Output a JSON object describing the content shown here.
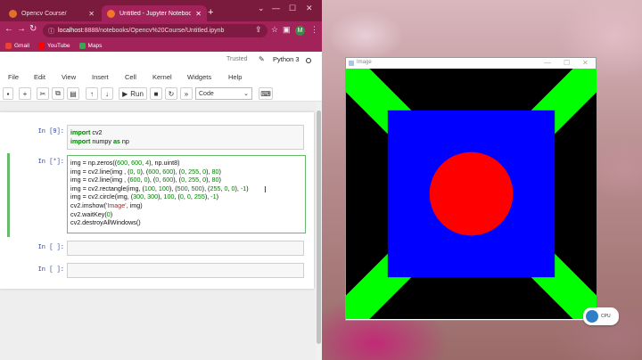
{
  "browser": {
    "tabs": [
      {
        "title": "Opencv Course/",
        "active": false,
        "favicon_color": "#e46f2a"
      },
      {
        "title": "Untitled - Jupyter Notebook",
        "active": true,
        "favicon_color": "#f37626"
      }
    ],
    "url_host": "localhost",
    "url_path": ":8888/notebooks/Opencv%20Course/Untitled.ipynb",
    "bookmarks": [
      {
        "label": "Gmail",
        "icon": "gmail-icon",
        "color": "#ea4335"
      },
      {
        "label": "YouTube",
        "icon": "youtube-icon",
        "color": "#ff0000"
      },
      {
        "label": "Maps",
        "icon": "maps-icon",
        "color": "#34a853"
      }
    ],
    "avatar_letter": "M",
    "theme_color": "#a2225a"
  },
  "jupyter": {
    "trusted_label": "Trusted",
    "kernel_name": "Python 3",
    "menus": [
      "File",
      "Edit",
      "View",
      "Insert",
      "Cell",
      "Kernel",
      "Widgets",
      "Help"
    ],
    "run_label": "Run",
    "cell_type": "Code",
    "cells": [
      {
        "prompt": "In [9]:",
        "lines": [
          [
            {
              "t": "import",
              "c": "kw"
            },
            {
              "t": " cv2",
              "c": ""
            }
          ],
          [
            {
              "t": "import",
              "c": "kw"
            },
            {
              "t": " numpy ",
              "c": ""
            },
            {
              "t": "as",
              "c": "kw"
            },
            {
              "t": " np",
              "c": ""
            }
          ]
        ]
      },
      {
        "prompt": "In [*]:",
        "lines": [
          [
            {
              "t": "img = np.zeros((",
              "c": ""
            },
            {
              "t": "600",
              "c": "num"
            },
            {
              "t": ", ",
              "c": ""
            },
            {
              "t": "600",
              "c": "num"
            },
            {
              "t": ", ",
              "c": ""
            },
            {
              "t": "4",
              "c": "num"
            },
            {
              "t": "), np.uint8)",
              "c": ""
            }
          ],
          [
            {
              "t": "img = cv2.line(img , (",
              "c": ""
            },
            {
              "t": "0",
              "c": "num"
            },
            {
              "t": ", ",
              "c": ""
            },
            {
              "t": "0",
              "c": "num"
            },
            {
              "t": "), (",
              "c": ""
            },
            {
              "t": "600",
              "c": "num"
            },
            {
              "t": ", ",
              "c": ""
            },
            {
              "t": "600",
              "c": "num"
            },
            {
              "t": "), (",
              "c": ""
            },
            {
              "t": "0",
              "c": "num"
            },
            {
              "t": ", ",
              "c": ""
            },
            {
              "t": "255",
              "c": "num"
            },
            {
              "t": ", ",
              "c": ""
            },
            {
              "t": "0",
              "c": "num"
            },
            {
              "t": "), ",
              "c": ""
            },
            {
              "t": "80",
              "c": "num"
            },
            {
              "t": ")",
              "c": ""
            }
          ],
          [
            {
              "t": "img = cv2.line(img , (",
              "c": ""
            },
            {
              "t": "600",
              "c": "num"
            },
            {
              "t": ", ",
              "c": ""
            },
            {
              "t": "0",
              "c": "num"
            },
            {
              "t": "), (",
              "c": ""
            },
            {
              "t": "0",
              "c": "num"
            },
            {
              "t": ", ",
              "c": ""
            },
            {
              "t": "600",
              "c": "num"
            },
            {
              "t": "), (",
              "c": ""
            },
            {
              "t": "0",
              "c": "num"
            },
            {
              "t": ", ",
              "c": ""
            },
            {
              "t": "255",
              "c": "num"
            },
            {
              "t": ", ",
              "c": ""
            },
            {
              "t": "0",
              "c": "num"
            },
            {
              "t": "), ",
              "c": ""
            },
            {
              "t": "80",
              "c": "num"
            },
            {
              "t": ")",
              "c": ""
            }
          ],
          [
            {
              "t": "img = cv2.rectangle(img, (",
              "c": ""
            },
            {
              "t": "100",
              "c": "num"
            },
            {
              "t": ", ",
              "c": ""
            },
            {
              "t": "100",
              "c": "num"
            },
            {
              "t": "), (",
              "c": ""
            },
            {
              "t": "500",
              "c": "num"
            },
            {
              "t": ", ",
              "c": ""
            },
            {
              "t": "500",
              "c": "num"
            },
            {
              "t": "), (",
              "c": ""
            },
            {
              "t": "255",
              "c": "num"
            },
            {
              "t": ", ",
              "c": ""
            },
            {
              "t": "0",
              "c": "num"
            },
            {
              "t": ", ",
              "c": ""
            },
            {
              "t": "0",
              "c": "num"
            },
            {
              "t": "), ",
              "c": ""
            },
            {
              "t": "-1",
              "c": "num"
            },
            {
              "t": ")",
              "c": ""
            }
          ],
          [
            {
              "t": "img = cv2.circle(img, (",
              "c": ""
            },
            {
              "t": "300",
              "c": "num"
            },
            {
              "t": ", ",
              "c": ""
            },
            {
              "t": "300",
              "c": "num"
            },
            {
              "t": "), ",
              "c": ""
            },
            {
              "t": "100",
              "c": "num"
            },
            {
              "t": ", (",
              "c": ""
            },
            {
              "t": "0",
              "c": "num"
            },
            {
              "t": ", ",
              "c": ""
            },
            {
              "t": "0",
              "c": "num"
            },
            {
              "t": ", ",
              "c": ""
            },
            {
              "t": "255",
              "c": "num"
            },
            {
              "t": "), ",
              "c": ""
            },
            {
              "t": "-1",
              "c": "num"
            },
            {
              "t": ")",
              "c": ""
            }
          ],
          [
            {
              "t": "cv2.imshow(",
              "c": ""
            },
            {
              "t": "'Image'",
              "c": "str"
            },
            {
              "t": ", img)",
              "c": ""
            }
          ],
          [
            {
              "t": "cv2.waitKey(",
              "c": ""
            },
            {
              "t": "0",
              "c": "num"
            },
            {
              "t": ")",
              "c": ""
            }
          ],
          [
            {
              "t": "cv2.destroyAllWindows()",
              "c": ""
            }
          ]
        ]
      },
      {
        "prompt": "In [ ]:",
        "lines": []
      },
      {
        "prompt": "In [ ]:",
        "lines": []
      }
    ]
  },
  "cv_window": {
    "title": "Image",
    "colors": {
      "background": "#000000",
      "lines": "#00ff00",
      "rectangle": "#0000ff",
      "circle": "#ff0000"
    }
  },
  "tray": {
    "label": "CPU",
    "icon": "cpu-gauge-icon"
  }
}
